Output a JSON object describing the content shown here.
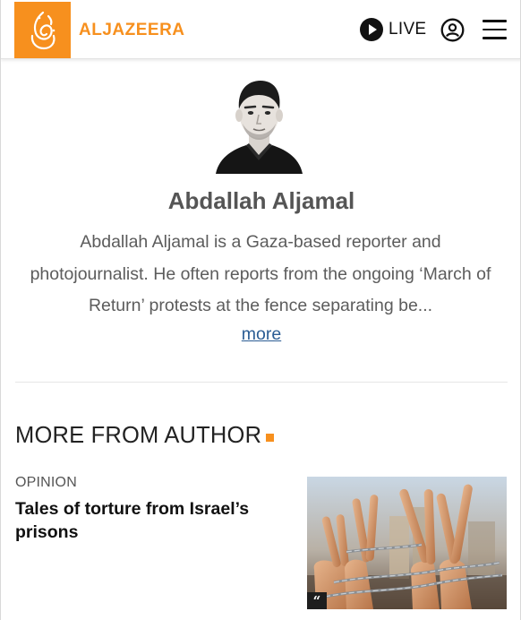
{
  "header": {
    "logo_text": "ALJAZEERA",
    "live_label": "LIVE",
    "icons": {
      "live": "play-circle-icon",
      "account": "user-circle-icon",
      "menu": "hamburger-menu-icon"
    },
    "brand_color": "#f7901e"
  },
  "author": {
    "name": "Abdallah Aljamal",
    "bio": "Abdallah Aljamal is a Gaza-based reporter and photojournalist. He often reports from the ongoing ‘March of Return’ protests at the fence separating be...",
    "more_label": "more"
  },
  "more_from_author": {
    "heading": "MORE FROM AUTHOR",
    "articles": [
      {
        "category": "OPINION",
        "title": "Tales of torture from Israel’s prisons",
        "badge_icon": "quote-icon",
        "badge_text": "“"
      }
    ]
  }
}
